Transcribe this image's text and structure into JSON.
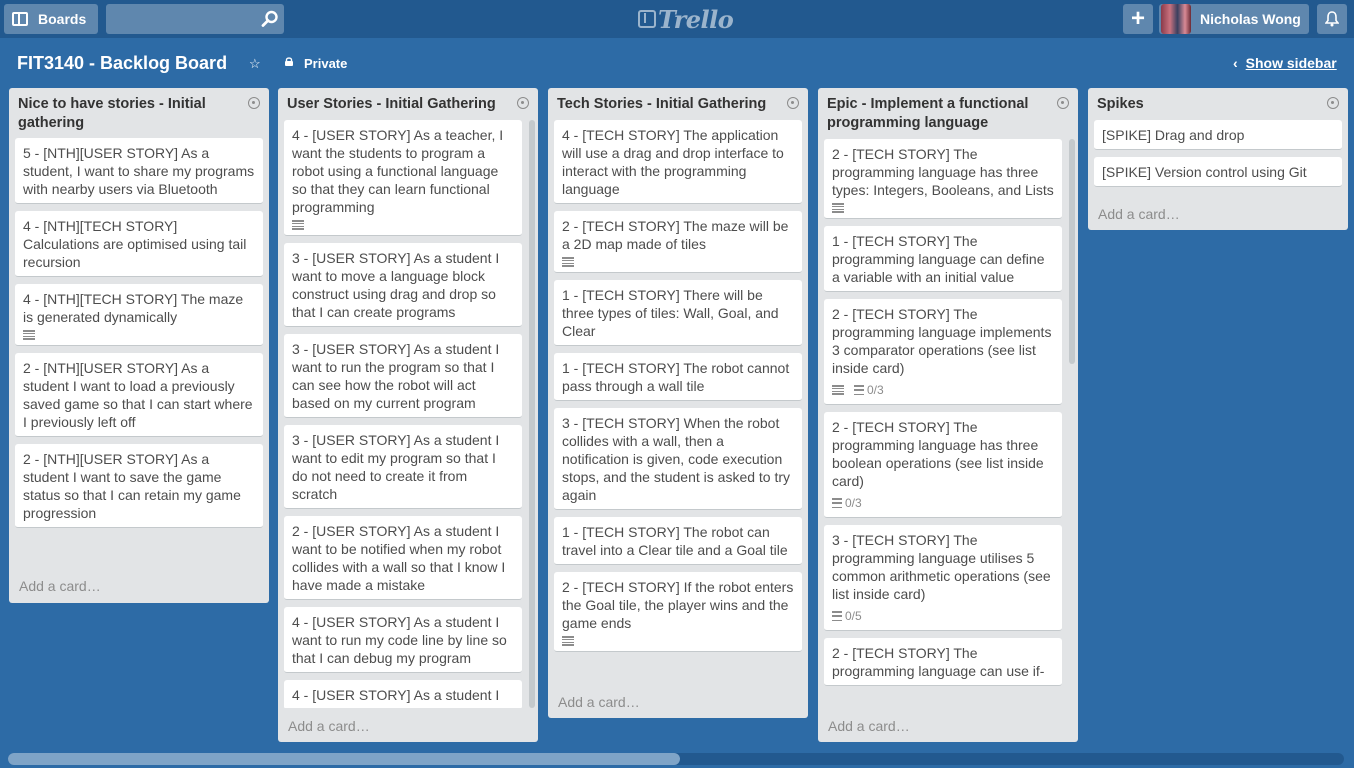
{
  "header": {
    "boards_label": "Boards",
    "search_placeholder": "",
    "logo": "Trello",
    "user_name": "Nicholas Wong"
  },
  "board": {
    "title": "FIT3140 - Backlog Board",
    "privacy": "Private",
    "show_sidebar": "Show sidebar"
  },
  "add_card_label": "Add a card…",
  "lists": [
    {
      "title": "Nice to have stories - Initial gathering",
      "cards": [
        {
          "text": "5 - [NTH][USER STORY] As a student, I want to share my programs with nearby users via Bluetooth"
        },
        {
          "text": "4 - [NTH][TECH STORY] Calculations are optimised using tail recursion"
        },
        {
          "text": "4 - [NTH][TECH STORY] The maze is generated dynamically",
          "desc": true
        },
        {
          "text": "2 - [NTH][USER STORY] As a student I want to load a previously saved game so that I can start where I previously left off"
        },
        {
          "text": "2 - [NTH][USER STORY] As a student I want to save the game status so that I can retain my game progression"
        }
      ]
    },
    {
      "title": "User Stories - Initial Gathering",
      "cards": [
        {
          "text": "4 - [USER STORY] As a teacher, I want the students to program a robot using a functional language so that they can learn functional programming",
          "desc": true
        },
        {
          "text": "3 - [USER STORY] As a student I want to move a language block construct using drag and drop so that I can create programs"
        },
        {
          "text": "3 - [USER STORY] As a student I want to run the program so that I can see how the robot will act based on my current program"
        },
        {
          "text": "3 - [USER STORY] As a student I want to edit my program so that I do not need to create it from scratch"
        },
        {
          "text": "2 - [USER STORY] As a student I want to be notified when my robot collides with a wall so that I know I have made a mistake"
        },
        {
          "text": "4 - [USER STORY] As a student I want to run my code line by line so that I can debug my program"
        },
        {
          "text": "4 - [USER STORY] As a student I"
        }
      ]
    },
    {
      "title": "Tech Stories - Initial Gathering",
      "cards": [
        {
          "text": "4 - [TECH STORY] The application will use a drag and drop interface to interact with the programming language"
        },
        {
          "text": "2 - [TECH STORY] The maze will be a 2D map made of tiles",
          "desc": true
        },
        {
          "text": "1 - [TECH STORY] There will be three types of tiles: Wall, Goal, and Clear"
        },
        {
          "text": "1 - [TECH STORY] The robot cannot pass through a wall tile"
        },
        {
          "text": "3 - [TECH STORY] When the robot collides with a wall, then a notification is given, code execution stops, and the student is asked to try again"
        },
        {
          "text": "1 - [TECH STORY] The robot can travel into a Clear tile and a Goal tile"
        },
        {
          "text": "2 - [TECH STORY] If the robot enters the Goal tile, the player wins and the game ends",
          "desc": true
        }
      ]
    },
    {
      "title": "Epic - Implement a functional programming language",
      "cards": [
        {
          "text": "2 - [TECH STORY] The programming language has three types: Integers, Booleans, and Lists",
          "desc": true
        },
        {
          "text": "1 - [TECH STORY] The programming language can define a variable with an initial value"
        },
        {
          "text": "2 - [TECH STORY] The programming language implements 3 comparator operations (see list inside card)",
          "desc": true,
          "checklist": "0/3"
        },
        {
          "text": "2 - [TECH STORY] The programming language has three boolean operations (see list inside card)",
          "checklist": "0/3"
        },
        {
          "text": "3 - [TECH STORY] The programming language utilises 5 common arithmetic operations (see list inside card)",
          "checklist": "0/5"
        },
        {
          "text": "2 - [TECH STORY] The programming language can use if-"
        }
      ]
    },
    {
      "title": "Spikes",
      "cards": [
        {
          "text": "[SPIKE] Drag and drop"
        },
        {
          "text": "[SPIKE] Version control using Git"
        }
      ]
    }
  ]
}
